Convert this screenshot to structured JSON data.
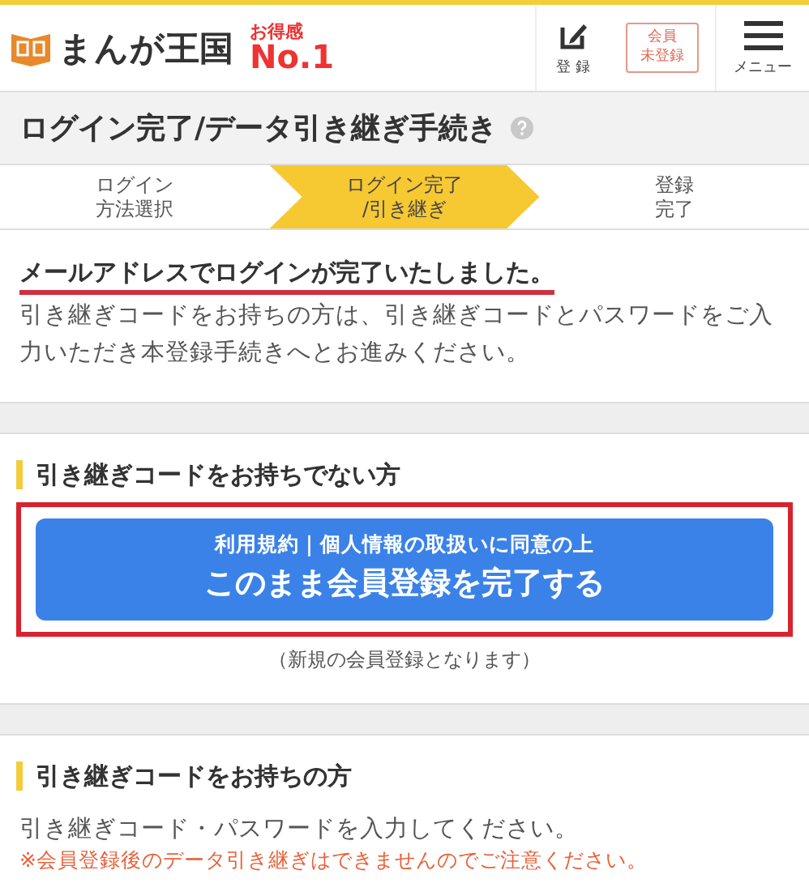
{
  "header": {
    "logo": "まんが王国",
    "badge_top": "お得感",
    "badge_bottom": "No.1",
    "register_label": "登 録",
    "member_status": [
      "会員",
      "未登録"
    ],
    "menu_label": "メニュー"
  },
  "page_title": "ログイン完了/データ引き継ぎ手続き",
  "steps": [
    {
      "lines": [
        "ログイン",
        "方法選択"
      ],
      "selected": false
    },
    {
      "lines": [
        "ログイン完了",
        "/引き継ぎ"
      ],
      "selected": true
    },
    {
      "lines": [
        "登録",
        "完了"
      ],
      "selected": false
    }
  ],
  "message": {
    "headline": "メールアドレスでログインが完了いたしました。",
    "body": "引き継ぎコードをお持ちの方は、引き継ぎコードとパスワードをご入力いただき本登録手続きへとお進みください。"
  },
  "no_code_section": {
    "heading": "引き継ぎコードをお持ちでない方",
    "button_sub": "利用規約｜個人情報の取扱いに同意の上",
    "button_main": "このまま会員登録を完了する",
    "note": "（新規の会員登録となります）"
  },
  "code_section": {
    "heading": "引き継ぎコードをお持ちの方",
    "instruction": "引き継ぎコード・パスワードを入力してください。",
    "warning": "※会員登録後のデータ引き継ぎはできませんのでご注意ください。"
  }
}
